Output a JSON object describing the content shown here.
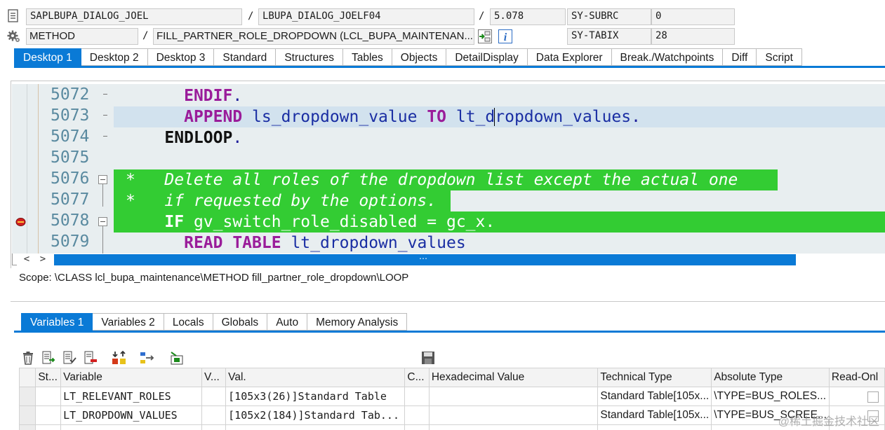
{
  "header": {
    "program": "SAPLBUPA_DIALOG_JOEL",
    "include": "LBUPA_DIALOG_JOELF04",
    "line": "5.078",
    "subrc_label": "SY-SUBRC",
    "subrc_value": "0",
    "event_type": "METHOD",
    "event_name": "FILL_PARTNER_ROLE_DROPDOWN (LCL_BUPA_MAINTENAN...",
    "tabix_label": "SY-TABIX",
    "tabix_value": "28",
    "sep": "/"
  },
  "tabs": [
    "Desktop 1",
    "Desktop 2",
    "Desktop 3",
    "Standard",
    "Structures",
    "Tables",
    "Objects",
    "DetailDisplay",
    "Data Explorer",
    "Break./Watchpoints",
    "Diff",
    "Script"
  ],
  "code": {
    "line_numbers": [
      "5072",
      "5073",
      "5074",
      "5075",
      "5076",
      "5077",
      "5078",
      "5079"
    ],
    "line5072_kw": "ENDIF",
    "line5073_kw1": "APPEND",
    "line5073_var1": "ls_dropdown_value",
    "line5073_kw2": "TO",
    "line5073_var2a": "lt_d",
    "line5073_var2b": "ropdown_values",
    "line5074_kw": "ENDLOOP",
    "line5076": "*   Delete all roles of the dropdown list except the actual one",
    "line5077": "*   if requested by the options.",
    "line5078_kw": "IF",
    "line5078_rest": "gv_switch_role_disabled = gc_x.",
    "line5079_kw": "READ TABLE",
    "line5079_rest": "lt_dropdown_values",
    "dot": ".",
    "scroll_left": "<",
    "scroll_right": ">",
    "scroll_grip": "⋯"
  },
  "scope": "Scope: \\CLASS lcl_bupa_maintenance\\METHOD fill_partner_role_dropdown\\LOOP",
  "var_tabs": [
    "Variables 1",
    "Variables 2",
    "Locals",
    "Globals",
    "Auto",
    "Memory Analysis"
  ],
  "table": {
    "headers": [
      "St...",
      "Variable",
      "V...",
      "Val.",
      "C...",
      "Hexadecimal Value",
      "Technical Type",
      "Absolute Type",
      "Read-Onl"
    ],
    "rows": [
      {
        "variable": "LT_RELEVANT_ROLES",
        "value": "[105x3(26)]Standard Table",
        "tech": "Standard Table[105x...",
        "abs": "\\TYPE=BUS_ROLES..."
      },
      {
        "variable": "LT_DROPDOWN_VALUES",
        "value": "[105x2(184)]Standard Tab...",
        "tech": "Standard Table[105x...",
        "abs": "\\TYPE=BUS_SCREE..."
      }
    ]
  },
  "watermark": "@稀土掘金技术社区",
  "colors": {
    "accent": "#0a7ad6",
    "highlight": "#33cc33",
    "code_bg": "#e8eef0"
  }
}
